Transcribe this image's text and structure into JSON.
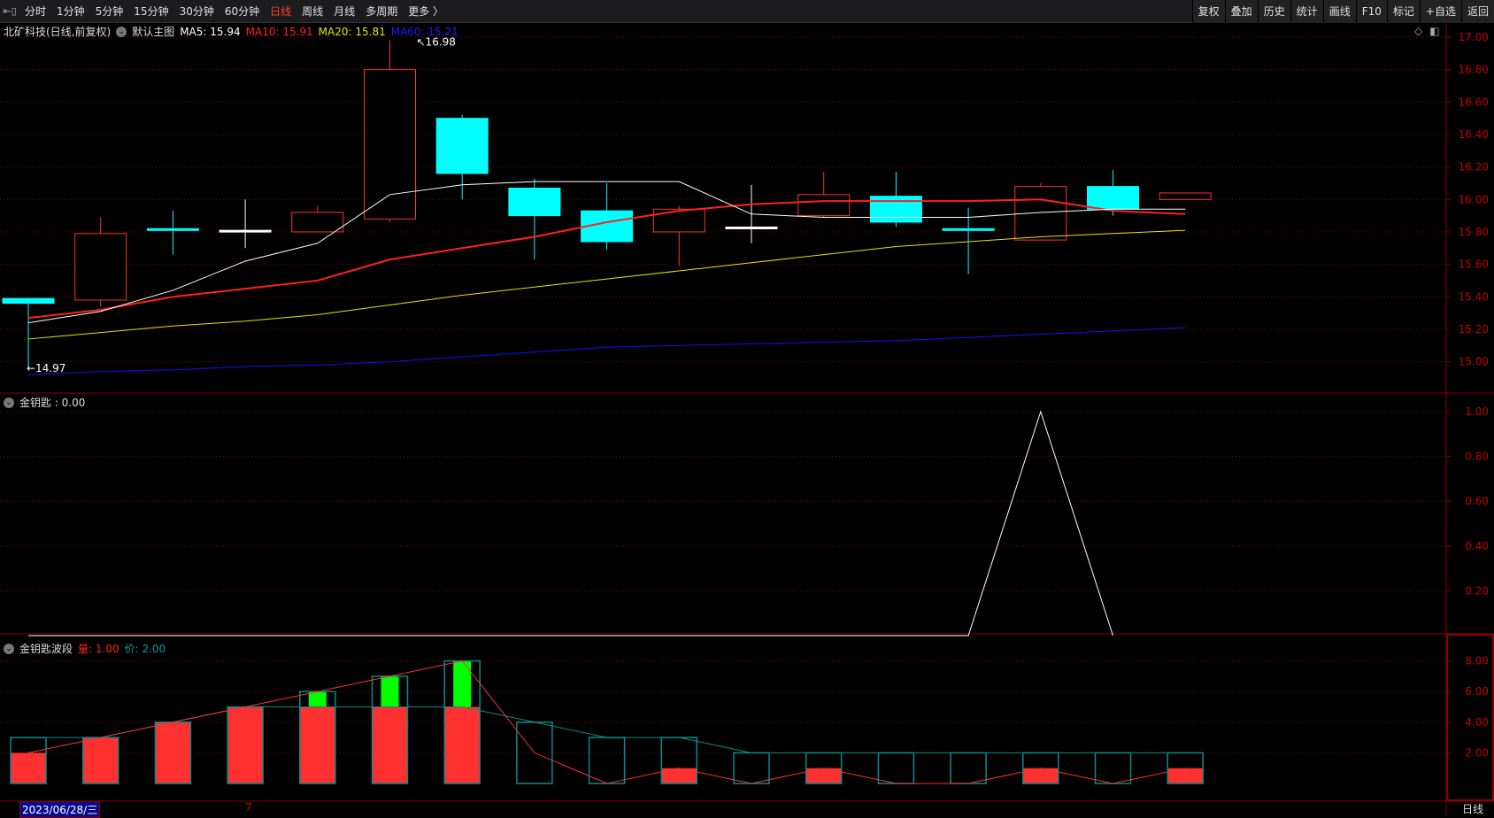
{
  "toolbar": {
    "tabs": [
      "分时",
      "1分钟",
      "5分钟",
      "15分钟",
      "30分钟",
      "60分钟",
      "日线",
      "周线",
      "月线",
      "多周期",
      "更多 〉"
    ],
    "active": "日线",
    "right_buttons": [
      "复权",
      "叠加",
      "历史",
      "统计",
      "画线",
      "F10",
      "标记",
      "+自选",
      "返回"
    ]
  },
  "main": {
    "title": "北矿科技(日线,前复权)",
    "template": "默认主图",
    "ma5": "MA5: 15.94",
    "ma10": "MA10: 15.91",
    "ma20": "MA20: 15.81",
    "ma60": "MA60: 15.21",
    "high_label": "16.98",
    "low_label": "14.97",
    "axis": [
      "17.00",
      "16.80",
      "16.60",
      "16.40",
      "16.20",
      "16.00",
      "15.80",
      "15.60",
      "15.40",
      "15.20",
      "15.00"
    ]
  },
  "panel2": {
    "title": "金钥匙 : 0.00",
    "axis": [
      "1.00",
      "0.80",
      "0.60",
      "0.40",
      "0.20"
    ]
  },
  "panel3": {
    "title": "金钥匙波段",
    "vol": "量: 1.00",
    "price": "价: 2.00",
    "axis": [
      "8.00",
      "6.00",
      "4.00",
      "2.00"
    ]
  },
  "datebar": {
    "date": "2023/06/28/三",
    "month": "7",
    "period": "日线"
  },
  "colors": {
    "up": "#ff3030",
    "down": "#00ffff",
    "ma5": "#ffffff",
    "ma10": "#ff2020",
    "ma20": "#e6e600",
    "ma60": "#1010ff",
    "grid": "#8b0000",
    "teal": "#0a8a8a",
    "green": "#00ff00"
  },
  "chart_data": {
    "type": "candlestick",
    "candles": [
      [
        15.39,
        15.39,
        14.97,
        15.36
      ],
      [
        15.38,
        15.89,
        15.34,
        15.79
      ],
      [
        15.82,
        15.93,
        15.66,
        15.82
      ],
      [
        15.81,
        16.0,
        15.7,
        15.81
      ],
      [
        15.8,
        15.96,
        15.8,
        15.92
      ],
      [
        15.88,
        16.98,
        15.86,
        16.8
      ],
      [
        16.5,
        16.52,
        16.0,
        16.16
      ],
      [
        16.07,
        16.13,
        15.63,
        15.9
      ],
      [
        15.93,
        16.1,
        15.69,
        15.74
      ],
      [
        15.8,
        15.96,
        15.59,
        15.94
      ],
      [
        15.83,
        16.09,
        15.73,
        15.83
      ],
      [
        15.9,
        16.17,
        15.89,
        16.03
      ],
      [
        16.02,
        16.17,
        15.83,
        15.86
      ],
      [
        15.82,
        15.95,
        15.54,
        15.82
      ],
      [
        15.75,
        16.1,
        15.75,
        16.08
      ],
      [
        16.08,
        16.18,
        15.9,
        15.94
      ],
      [
        16.0,
        16.04,
        16.0,
        16.04
      ]
    ],
    "ma5": [
      15.24,
      15.31,
      15.44,
      15.62,
      15.73,
      16.03,
      16.09,
      16.11,
      16.11,
      16.11,
      15.91,
      15.89,
      15.89,
      15.89,
      15.92,
      15.94,
      15.94
    ],
    "ma10": [
      15.27,
      15.32,
      15.4,
      15.45,
      15.5,
      15.63,
      15.7,
      15.77,
      15.86,
      15.93,
      15.97,
      15.99,
      15.99,
      15.99,
      16.0,
      15.93,
      15.91
    ],
    "ma20": [
      15.14,
      15.18,
      15.22,
      15.25,
      15.29,
      15.35,
      15.41,
      15.46,
      15.51,
      15.56,
      15.61,
      15.66,
      15.71,
      15.74,
      15.77,
      15.79,
      15.81
    ],
    "ma60": [
      14.92,
      14.94,
      14.95,
      14.97,
      14.98,
      15.0,
      15.03,
      15.06,
      15.09,
      15.1,
      15.11,
      15.12,
      15.13,
      15.15,
      15.17,
      15.19,
      15.21
    ],
    "key": [
      0,
      0,
      0,
      0,
      0,
      0,
      0,
      0,
      0,
      0,
      0,
      0,
      0,
      0,
      1,
      0,
      0
    ],
    "band_box": [
      3,
      3,
      4,
      5,
      6,
      7,
      8,
      4,
      3,
      3,
      2,
      2,
      2,
      2,
      2,
      2,
      2
    ],
    "band_red": [
      2,
      3,
      4,
      5,
      5,
      5,
      5,
      0,
      0,
      1,
      0,
      1,
      0,
      0,
      1,
      0,
      1
    ],
    "band_green": [
      0,
      0,
      0,
      0,
      6,
      7,
      8,
      0,
      0,
      0,
      0,
      0,
      0,
      0,
      0,
      0,
      0
    ],
    "band_redline": [
      2,
      3,
      4,
      5,
      6,
      7,
      8,
      2,
      0,
      1,
      0,
      1,
      0,
      0,
      1,
      0,
      1
    ],
    "band_tealline": [
      3,
      3,
      4,
      5,
      5,
      5,
      5,
      4,
      3,
      3,
      2,
      2,
      2,
      2,
      2,
      2,
      2
    ],
    "price_range": [
      15.0,
      17.0
    ],
    "key_range": [
      0,
      1
    ],
    "band_range": [
      0,
      8
    ]
  }
}
